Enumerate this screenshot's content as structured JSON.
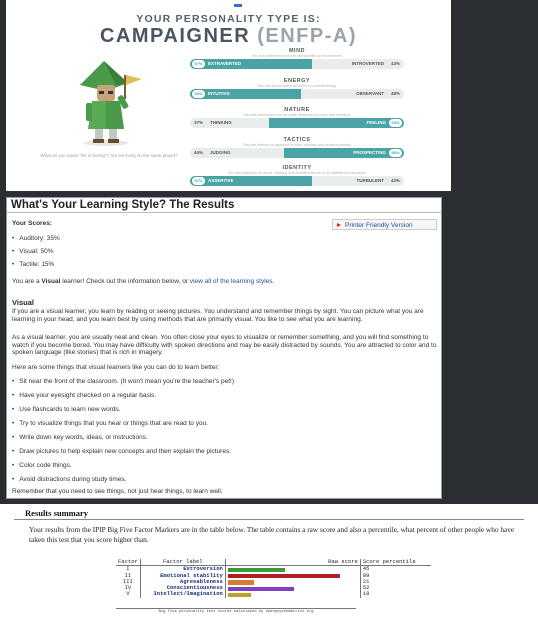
{
  "personality": {
    "kicker": "YOUR PERSONALITY TYPE IS:",
    "type_name": "CAMPAIGNER",
    "type_code": "(ENFP-A)",
    "caption": "What do you mean \"life is boring\"? Are we living on the same planet?",
    "traits": [
      {
        "title": "MIND",
        "desc": "This trait determines how we interact with our environment.",
        "left": "EXTRAVERTED",
        "right": "INTROVERTED",
        "left_pct": "57%",
        "right_pct": "43%",
        "fill_side": "left",
        "value": 57
      },
      {
        "title": "ENERGY",
        "desc": "This trait shows where we direct our mental energy.",
        "left": "INTUITIVE",
        "right": "OBSERVANT",
        "left_pct": "52%",
        "right_pct": "48%",
        "fill_side": "left",
        "value": 52
      },
      {
        "title": "NATURE",
        "desc": "This trait determines how we make decisions and cope with emotions.",
        "left": "THINKING",
        "right": "FEELING",
        "left_pct": "37%",
        "right_pct": "63%",
        "fill_side": "right",
        "value": 63
      },
      {
        "title": "TACTICS",
        "desc": "This trait reflects our approach to work, planning and decision-making.",
        "left": "JUDGING",
        "right": "PROSPECTING",
        "left_pct": "44%",
        "right_pct": "56%",
        "fill_side": "right",
        "value": 56
      },
      {
        "title": "IDENTITY",
        "desc": "This trait underpins all others, showing how confident we are in our abilities and decisions.",
        "left": "ASSERTIVE",
        "right": "TURBULENT",
        "left_pct": "57%",
        "right_pct": "43%",
        "fill_side": "left",
        "value": 57
      }
    ]
  },
  "learning": {
    "title": "What's Your Learning Style? The Results",
    "scores_heading": "Your Scores:",
    "printer_button": "Printer Friendly Version",
    "scores": [
      "Auditory: 35%",
      "Visual: 50%",
      "Tactile: 15%"
    ],
    "result_line_pre": "You are a ",
    "result_bold": "Visual",
    "result_line_mid": " learner! Check out the information below, or ",
    "result_link": "view all of the learning styles",
    "result_line_post": ".",
    "section_title": "Visual",
    "para1": "If you are a visual learner, you learn by reading or seeing pictures. You understand and remember things by sight. You can picture what you are learning in your head, and you learn best by using methods that are primarily visual. You like to see what you are learning.",
    "para2": "As a visual learner, you are usually neat and clean. You often close your eyes to visualize or remember something, and you will find something to watch if you become bored. You may have difficulty with spoken directions and may be easily distracted by sounds. You are attracted to color and to spoken language (like stories) that is rich in imagery.",
    "para3": "Here are some things that visual learners like you can do to learn better:",
    "tips": [
      "Sit near the front of the classroom. (It won't mean you're the teacher's pet!)",
      "Have your eyesight checked on a regular basis.",
      "Use flashcards to learn new words.",
      "Try to visualize things that you hear or things that are read to you.",
      "Write down key words, ideas, or instructions.",
      "Draw pictures to help explain new concepts and then explain the pictures.",
      "Color code things.",
      "Avoid distractions during study times."
    ],
    "closing": "Remember that you need to see things, not just hear things, to learn well."
  },
  "bigfive": {
    "heading": "Results summary",
    "intro": "Your results from the IPIP Big Five Factor Markers are in the table below. The table contains a raw score and also a percentile, what percent of other people who have taken this test that you score higher than.",
    "col_factor": "Factor",
    "col_label": "Factor label",
    "col_raw": "Raw score",
    "col_pct": "Score percentile",
    "rows": [
      {
        "factor": "I",
        "label": "Extroversion",
        "percentile": "45",
        "value": 45,
        "color": "#3a9a3a"
      },
      {
        "factor": "II",
        "label": "Emotional stability",
        "percentile": "89",
        "value": 89,
        "color": "#b02020"
      },
      {
        "factor": "III",
        "label": "Agreeableness",
        "percentile": "21",
        "value": 21,
        "color": "#d08030"
      },
      {
        "factor": "IV",
        "label": "Conscientiousness",
        "percentile": "52",
        "value": 52,
        "color": "#8040c0"
      },
      {
        "factor": "V",
        "label": "Intellect/Imagination",
        "percentile": "18",
        "value": 18,
        "color": "#c0a020"
      }
    ],
    "footer": "Big five personality test scores calculated by openpsychometrics.org"
  },
  "colors": {
    "teal": "#4aa3a5",
    "link": "#1c4fa8",
    "dark_bg": "#2b2f33"
  }
}
